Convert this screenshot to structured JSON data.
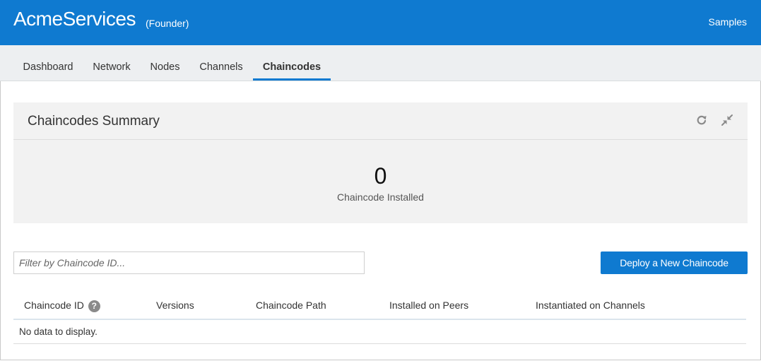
{
  "header": {
    "app_title": "AcmeServices",
    "role": "(Founder)",
    "samples_label": "Samples",
    "background_color": "#0f7ad0"
  },
  "tabs": [
    {
      "label": "Dashboard",
      "active": false
    },
    {
      "label": "Network",
      "active": false
    },
    {
      "label": "Nodes",
      "active": false
    },
    {
      "label": "Channels",
      "active": false
    },
    {
      "label": "Chaincodes",
      "active": true
    }
  ],
  "summary": {
    "title": "Chaincodes Summary",
    "icons": [
      "refresh-icon",
      "collapse-icon"
    ],
    "count": "0",
    "caption": "Chaincode Installed"
  },
  "filter": {
    "placeholder": "Filter by Chaincode ID...",
    "value": ""
  },
  "deploy_button_label": "Deploy a New Chaincode",
  "table": {
    "columns": [
      "Chaincode ID",
      "Versions",
      "Chaincode Path",
      "Installed on Peers",
      "Instantiated on Channels"
    ],
    "help_icon": "question-circle-icon",
    "help_symbol": "?",
    "empty_message": "No data to display."
  }
}
